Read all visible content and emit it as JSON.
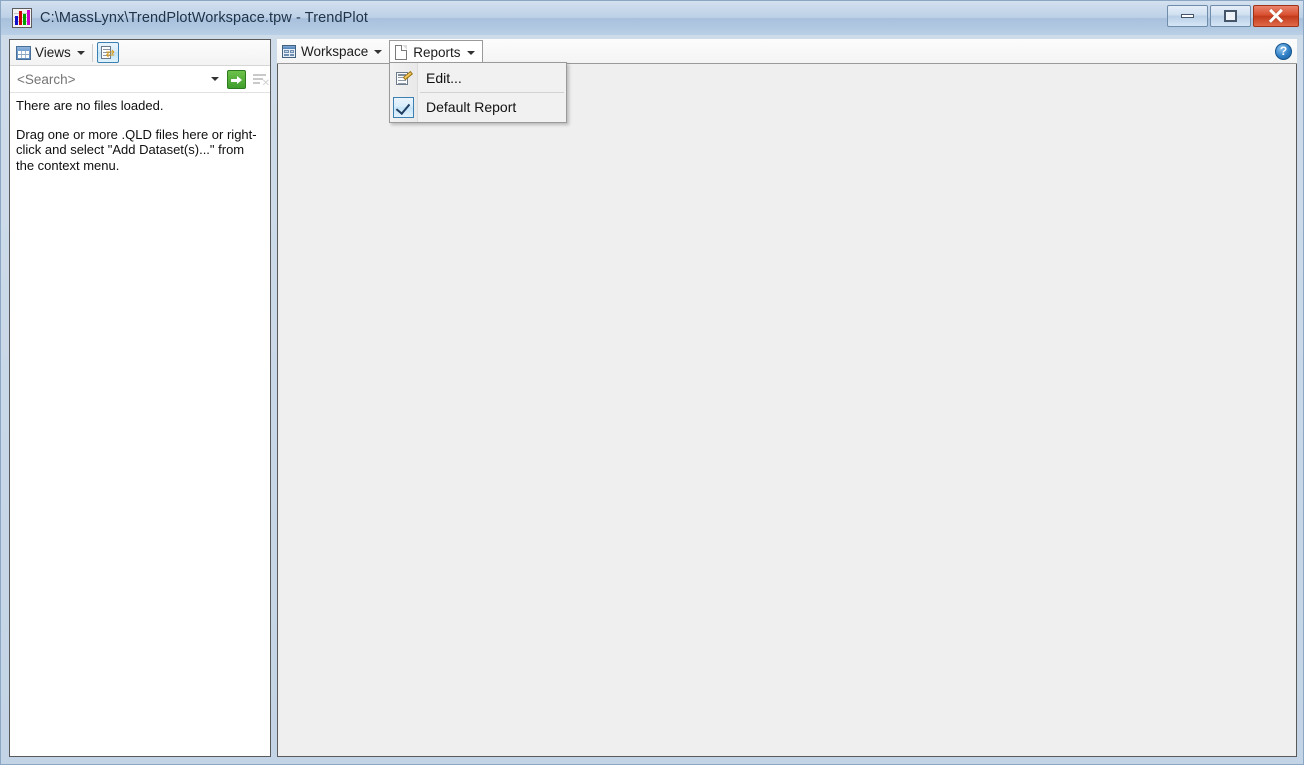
{
  "window": {
    "title": "C:\\MassLynx\\TrendPlotWorkspace.tpw - TrendPlot",
    "app_icon": "bar-chart-icon",
    "controls": {
      "minimize": "minimize-icon",
      "maximize": "maximize-icon",
      "close": "close-icon"
    },
    "accent_color": "#b9cfe6",
    "close_color": "#c23a1c"
  },
  "left_panel": {
    "toolbar": {
      "views_label": "Views",
      "views_icon": "table-grid-icon",
      "views_caret": "chevron-down-icon",
      "refresh_icon": "refresh-datasets-icon"
    },
    "search": {
      "value": "",
      "placeholder": "<Search>",
      "dropdown_icon": "chevron-down-icon",
      "go_icon": "green-arrow-go-icon",
      "clear_icon": "clear-filter-icon"
    },
    "empty_state": {
      "line1": "There are no files loaded.",
      "line2": "Drag one or more .QLD files here or right-click and select \"Add Dataset(s)...\" from the context menu."
    }
  },
  "right_panel": {
    "tabs": [
      {
        "label": "Workspace",
        "icon": "window-panes-icon",
        "caret": "chevron-down-icon",
        "active": false
      },
      {
        "label": "Reports",
        "icon": "document-icon",
        "caret": "chevron-down-icon",
        "active": true
      }
    ],
    "help_icon": "help-question-icon",
    "help_glyph": "?",
    "content_background": "#efefef"
  },
  "reports_menu": {
    "open": true,
    "items": [
      {
        "label": "Edit...",
        "icon": "edit-properties-icon",
        "checked": false
      },
      {
        "label": "Default Report",
        "icon": "checkbox-checked-icon",
        "checked": true
      }
    ]
  }
}
